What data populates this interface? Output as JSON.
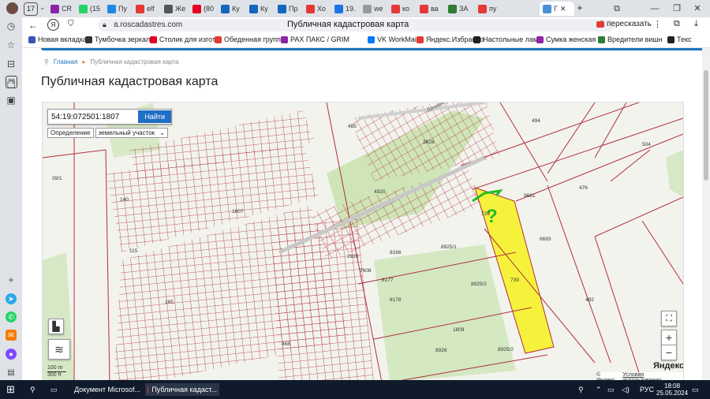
{
  "browser": {
    "tab_count": "17",
    "tabs": [
      {
        "label": "CR",
        "color": "#8e24aa"
      },
      {
        "label": "(15",
        "color": "#25d366"
      },
      {
        "label": "Пу",
        "color": "#1e88e5"
      },
      {
        "label": "elf",
        "color": "#e53935"
      },
      {
        "label": "Же",
        "color": "#555555"
      },
      {
        "label": "(80",
        "color": "#e60023"
      },
      {
        "label": "Ку",
        "color": "#1565c0"
      },
      {
        "label": "Ку",
        "color": "#1565c0"
      },
      {
        "label": "Пр",
        "color": "#1565c0"
      },
      {
        "label": "Хо",
        "color": "#e53935"
      },
      {
        "label": "19.",
        "color": "#1a73e8"
      },
      {
        "label": "we",
        "color": "#999999"
      },
      {
        "label": "ко",
        "color": "#e53935"
      },
      {
        "label": "ва",
        "color": "#e53935"
      },
      {
        "label": "ЗА",
        "color": "#2e7d32"
      },
      {
        "label": "пу",
        "color": "#e53935"
      }
    ],
    "active_tab_label": "Г",
    "url": "a.roscadastres.com",
    "page_title": "Публичная кадастровая карта",
    "retell_label": "пересказать",
    "bookmarks": [
      {
        "label": "Новая вкладка",
        "color": "#3f51b5"
      },
      {
        "label": "Тумбочка зеркал",
        "color": "#333333"
      },
      {
        "label": "Столик для изгот",
        "color": "#e60023"
      },
      {
        "label": "Обеденная групп",
        "color": "#e53935"
      },
      {
        "label": "PAX ПАКС / GRIM",
        "color": "#8e24aa"
      },
      {
        "label": "VK WorkMail",
        "color": "#0077ff"
      },
      {
        "label": "Яндекс.Избранно",
        "color": "#e53935"
      },
      {
        "label": "Настольные ламп",
        "color": "#222222"
      },
      {
        "label": "Сумка женская W",
        "color": "#8e24aa"
      },
      {
        "label": "Вредители вишн",
        "color": "#2e7d32"
      },
      {
        "label": "Текс",
        "color": "#222222"
      }
    ]
  },
  "sidebar": {
    "badge": "79"
  },
  "page": {
    "breadcrumb_home": "Главная",
    "breadcrumb_current": "Публичная кадастровая карта",
    "heading": "Публичная кадастровая карта"
  },
  "map": {
    "search_value": "54:19:072501:1807",
    "search_button": "Найти",
    "mode_label": "Определение",
    "mode_value": "земельный участок",
    "scale_m": "100 m",
    "scale_ft": "300 ft",
    "copyright": "© Яндекс",
    "terms": "Условия использования",
    "logo": "Яндекс",
    "highlight_color": "#f6f23c",
    "parcel_line_color": "#b0303a",
    "parcels": [
      {
        "label": "485"
      },
      {
        "label": "494"
      },
      {
        "label": "504"
      },
      {
        "label": "39/1"
      },
      {
        "label": "9681"
      },
      {
        "label": "476"
      },
      {
        "label": "8693"
      },
      {
        "label": "8925/1"
      },
      {
        "label": "8166"
      },
      {
        "label": "2920"
      },
      {
        "label": "7608"
      },
      {
        "label": "8177"
      },
      {
        "label": "8178"
      },
      {
        "label": "8925/2"
      },
      {
        "label": "739"
      },
      {
        "label": "482"
      },
      {
        "label": "8926"
      },
      {
        "label": "8925/2"
      },
      {
        "label": "468"
      },
      {
        "label": "4920"
      },
      {
        "label": "3828"
      },
      {
        "label": "165"
      },
      {
        "label": "140"
      },
      {
        "label": "115"
      },
      {
        "label": "729"
      },
      {
        "label": "1809"
      },
      {
        "label": "1807"
      }
    ],
    "road_label": "Дачная ул.",
    "annotation": "?"
  },
  "taskbar": {
    "item1": "Документ Microsof...",
    "item2": "Публичная кадаст...",
    "lang": "РУС",
    "time": "18:08",
    "date": "25.05.2024"
  }
}
